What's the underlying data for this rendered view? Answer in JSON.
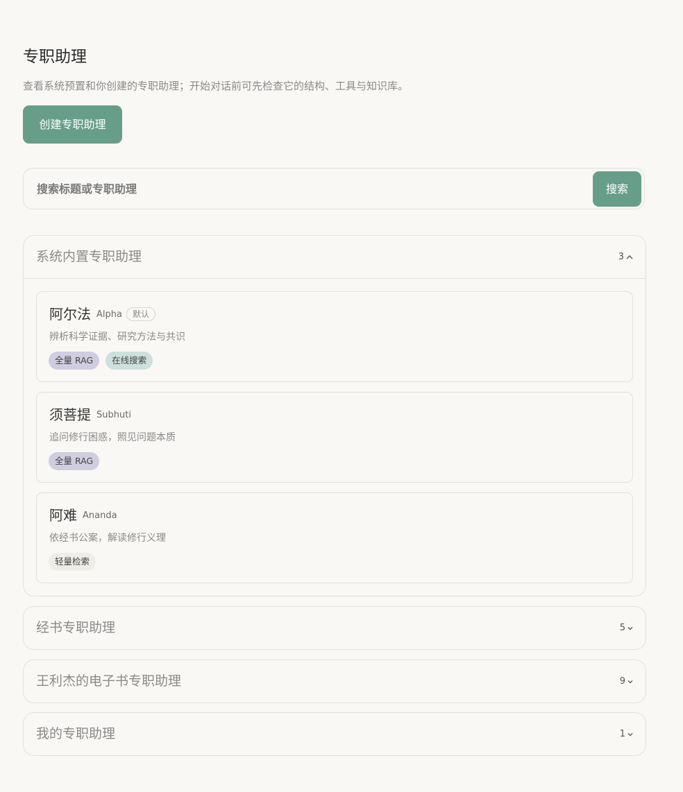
{
  "page": {
    "title": "专职助理",
    "subtitle": "查看系统预置和你创建的专职助理；开始对话前可先检查它的结构、工具与知识库。",
    "create_button": "创建专职助理"
  },
  "search": {
    "placeholder": "搜索标题或专职助理",
    "value": "",
    "button": "搜索"
  },
  "sections": [
    {
      "title": "系统内置专职助理",
      "count": "3",
      "expanded": true,
      "items": [
        {
          "name": "阿尔法",
          "en": "Alpha",
          "default_badge": "默认",
          "desc": "辨析科学证据、研究方法与共识",
          "tags": [
            "全量 RAG",
            "在线搜索"
          ]
        },
        {
          "name": "须菩提",
          "en": "Subhuti",
          "desc": "追问修行困惑，照见问题本质",
          "tags": [
            "全量 RAG"
          ]
        },
        {
          "name": "阿难",
          "en": "Ananda",
          "desc": "依经书公案，解读修行义理",
          "tags": [
            "轻量检索"
          ]
        }
      ]
    },
    {
      "title": "经书专职助理",
      "count": "5",
      "expanded": false
    },
    {
      "title": "王利杰的电子书专职助理",
      "count": "9",
      "expanded": false
    },
    {
      "title": "我的专职助理",
      "count": "1",
      "expanded": false
    }
  ],
  "colors": {
    "accent": "#679e8a",
    "background": "#f9f8f5",
    "border": "#e3e1dc",
    "tag_rag": "#cfcddf",
    "tag_online": "#cce0dc",
    "tag_light": "#eeede7"
  },
  "icons": {
    "expanded": "chevron-up-icon",
    "collapsed": "chevron-down-icon"
  }
}
